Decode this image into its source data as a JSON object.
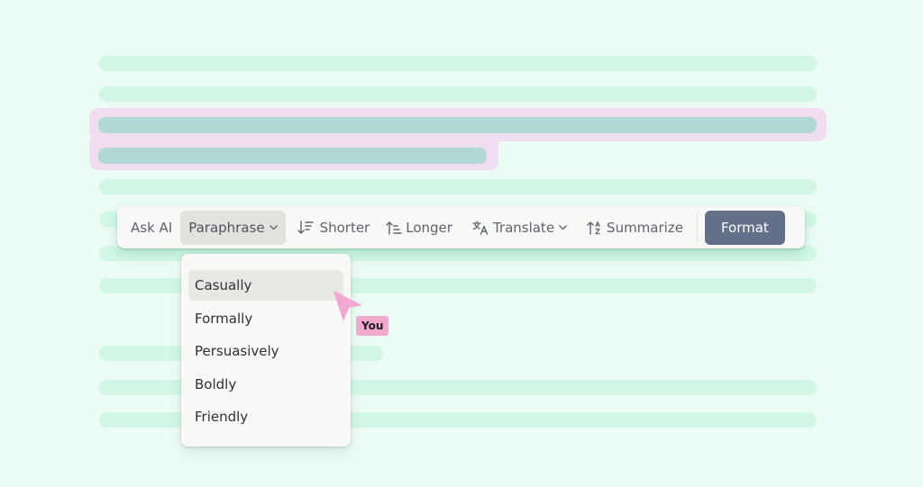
{
  "colors": {
    "background": "#EAFCF3",
    "placeholder_line": "#D2F7E6",
    "selection_highlight": "#F1DDF2",
    "selected_line": "#B2D8D5",
    "primary_button": "#647089",
    "cursor": "#F3A8D0"
  },
  "toolbar": {
    "items": [
      {
        "label": "Ask AI",
        "icon": null,
        "has_dropdown": false,
        "active": false
      },
      {
        "label": "Paraphrase",
        "icon": null,
        "has_dropdown": true,
        "active": true
      },
      {
        "label": "Shorter",
        "icon": "sort-descending-icon",
        "has_dropdown": false,
        "active": false
      },
      {
        "label": "Longer",
        "icon": "sort-ascending-icon",
        "has_dropdown": false,
        "active": false
      },
      {
        "label": "Translate",
        "icon": "translate-icon",
        "has_dropdown": true,
        "active": false
      },
      {
        "label": "Summarize",
        "icon": "sort-alpha-icon",
        "has_dropdown": false,
        "active": false
      }
    ],
    "primary_button": "Format"
  },
  "paraphrase_menu": {
    "options": [
      "Casually",
      "Formally",
      "Persuasively",
      "Boldly",
      "Friendly"
    ],
    "hovered": "Casually"
  },
  "collaborator_cursor": {
    "label": "You"
  }
}
